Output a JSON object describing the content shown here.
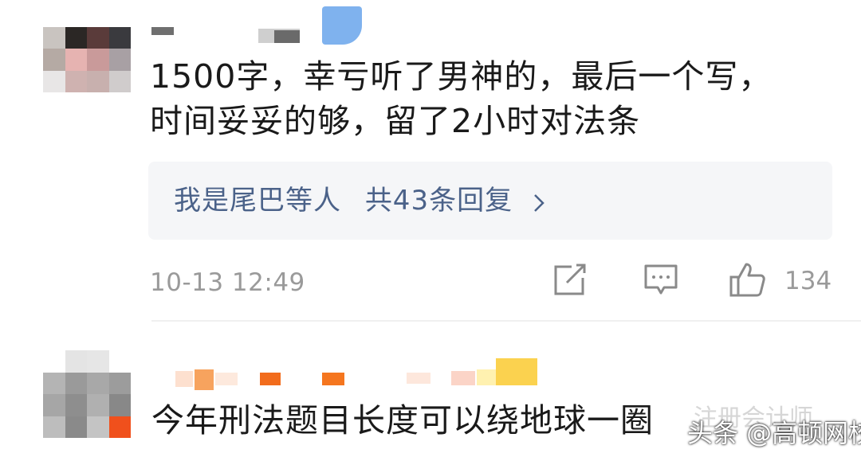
{
  "comments": [
    {
      "text_line1": "1500字，幸亏听了男神的，最后一个写，",
      "text_line2": "时间妥妥的够，留了2小时对法条",
      "reply_summary": {
        "user": "我是尾巴等人",
        "count_text": "共43条回复"
      },
      "timestamp": "10-13 12:49",
      "like_count": "134"
    },
    {
      "text": "今年刑法题目长度可以绕地球一圈"
    }
  ],
  "watermark": {
    "top_text": "注册会计师",
    "main_text": "头条 @高顿网校"
  },
  "icons": {
    "reply_chevron": "chevron-right-icon",
    "share": "share-edit-icon",
    "comment": "comment-bubble-icon",
    "like": "thumbs-up-icon"
  },
  "colors": {
    "reply_link": "#4b6289",
    "meta_gray": "#9a9a9a",
    "reply_box_bg": "#f5f6f8"
  }
}
